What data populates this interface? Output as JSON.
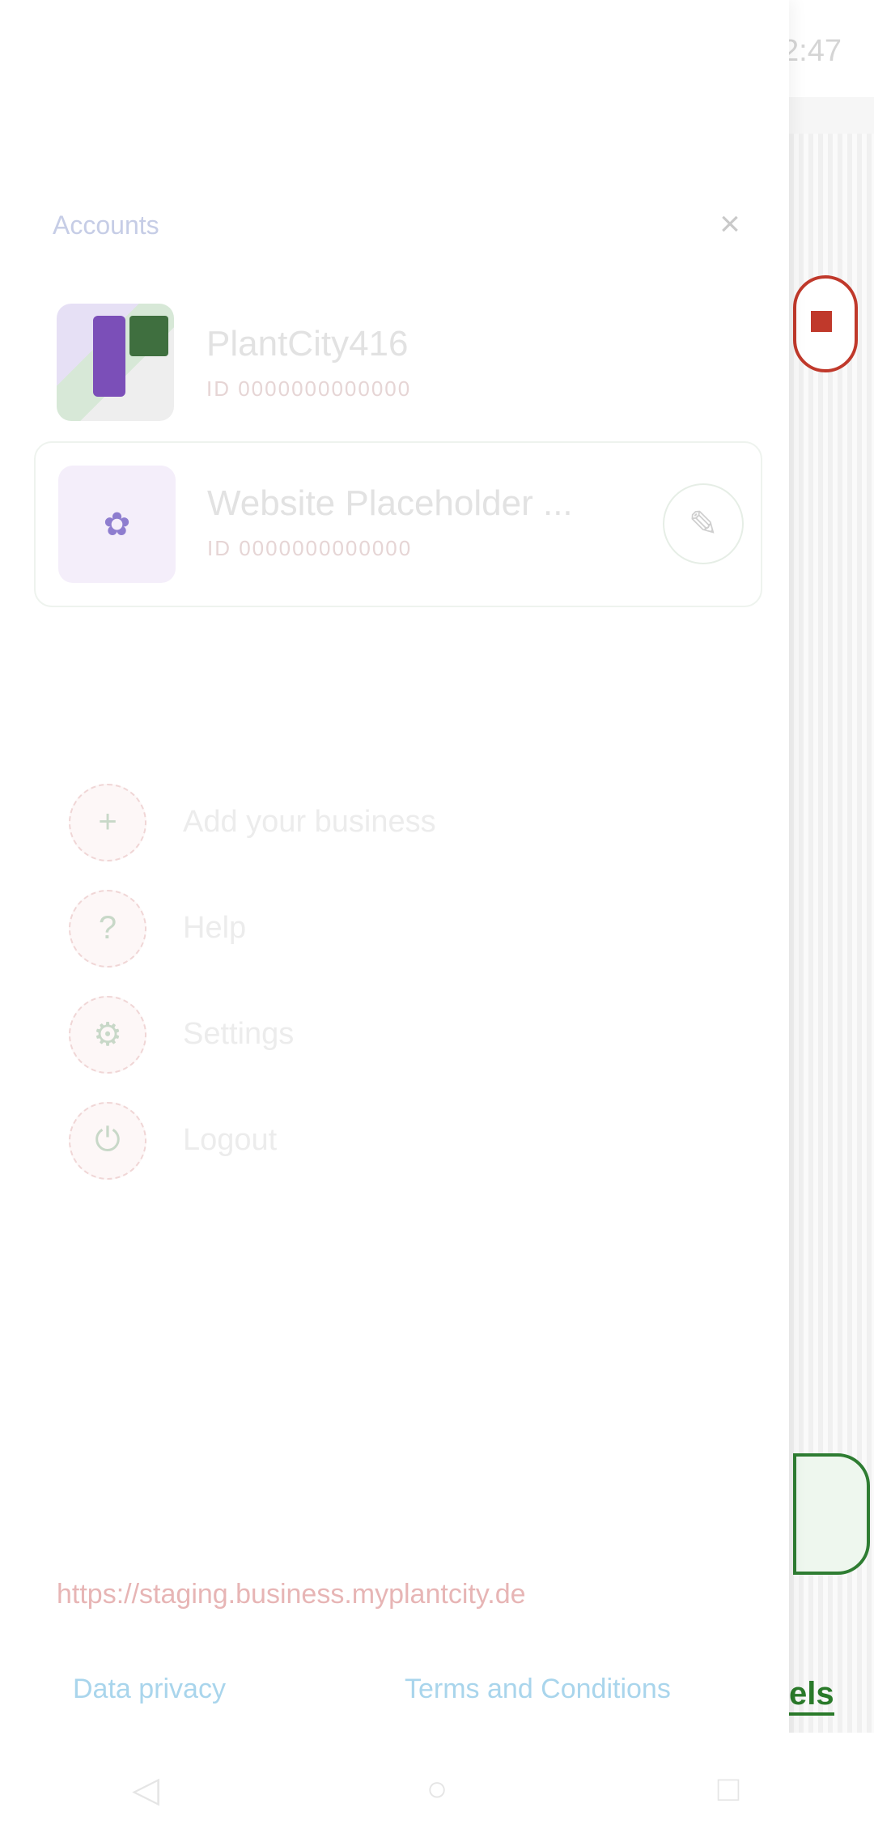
{
  "status_bar": {
    "left_text": "▲◢ 🔊 ☆",
    "time": "12:47"
  },
  "drawer": {
    "title": "Accounts",
    "close_icon": "×",
    "accounts": [
      {
        "name": "PlantCity416",
        "id": "ID 0000000000000"
      },
      {
        "name": "Website Placeholder ...",
        "id": "ID 0000000000000"
      }
    ],
    "edit_icon": "✎",
    "menu": [
      {
        "label": "Add your business",
        "icon": "+"
      },
      {
        "label": "Help",
        "icon": "?"
      },
      {
        "label": "Settings",
        "icon": "⚙"
      },
      {
        "label": "Logout",
        "icon": "⏻"
      }
    ],
    "site_link": "https://staging.business.myplantcity.de",
    "footer": {
      "privacy": "Data privacy",
      "terms": "Terms and Conditions"
    }
  },
  "background_app": {
    "label": "els"
  },
  "nav_bar": {
    "back_icon": "◁",
    "home_icon": "○",
    "recents_icon": "□"
  }
}
